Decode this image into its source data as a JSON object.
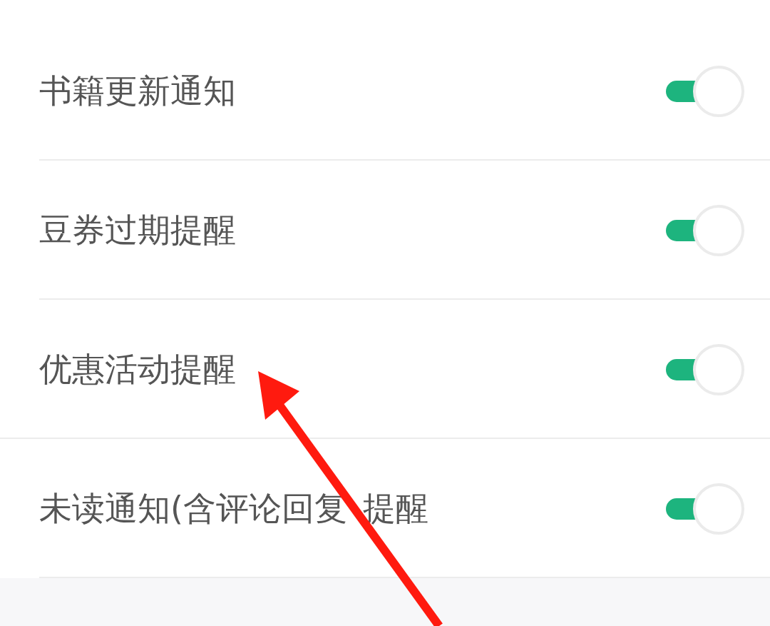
{
  "settings": [
    {
      "label": "书籍更新通知",
      "on": true,
      "divider_inset": true
    },
    {
      "label": "豆券过期提醒",
      "on": true,
      "divider_inset": true
    },
    {
      "label": "优惠活动提醒",
      "on": true,
      "divider_inset": false
    },
    {
      "label": "未读通知(含评论回复",
      "label_after_arrow": "提醒",
      "on": true,
      "divider_inset": true
    }
  ]
}
